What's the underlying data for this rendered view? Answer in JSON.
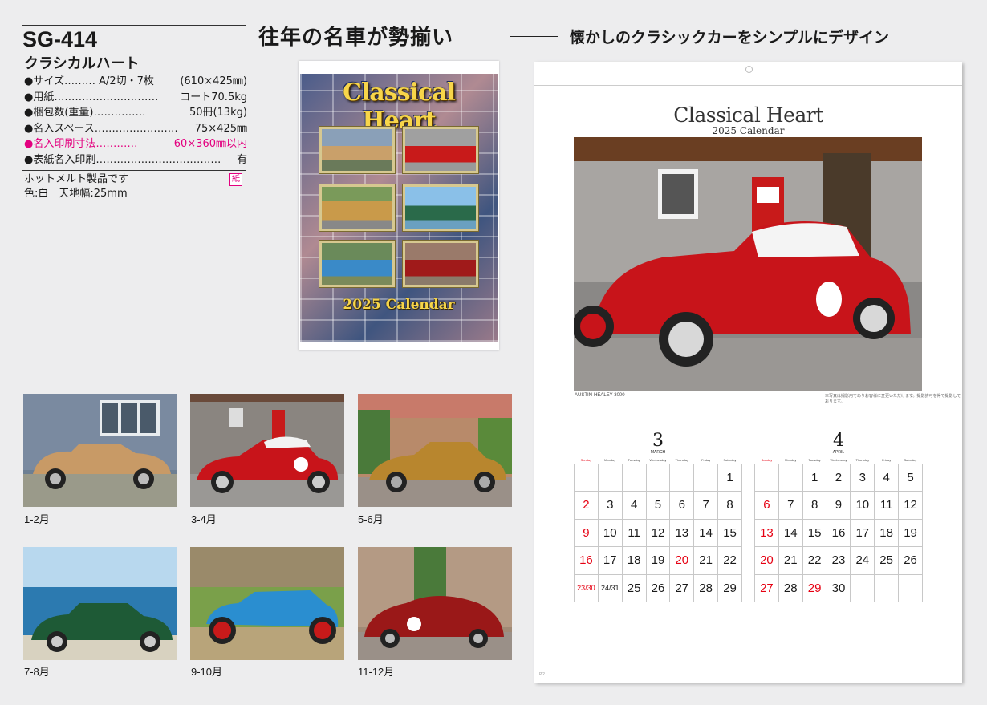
{
  "product": {
    "code": "SG-414",
    "name": "クラシカルハート"
  },
  "specs": [
    {
      "label": "●サイズ……… A/2切・7枚",
      "value": "(610×425㎜)"
    },
    {
      "label": "●用紙…………………………",
      "value": "コート70.5kg"
    },
    {
      "label": "●梱包数(重量)……………",
      "value": "50冊(13kg)"
    },
    {
      "label": "●名入スペース……………………",
      "value": "75×425㎜"
    },
    {
      "label": "●名入印刷寸法…………",
      "value": "60×360㎜以内"
    },
    {
      "label": "●表紙名入印刷………………………………",
      "value": "有"
    }
  ],
  "notes": {
    "line1": "ホットメルト製品です",
    "line2": "色:白　天地幅:25mm",
    "paper_badge": "紙"
  },
  "headline": {
    "main": "往年の名車が勢揃い",
    "sub": "懐かしのクラシックカーをシンプルにデザイン"
  },
  "cover": {
    "title": "Classical Heart",
    "year": "2025 Calendar"
  },
  "thumbnails": [
    {
      "label": "1-2月"
    },
    {
      "label": "3-4月"
    },
    {
      "label": "5-6月"
    },
    {
      "label": "7-8月"
    },
    {
      "label": "9-10月"
    },
    {
      "label": "11-12月"
    }
  ],
  "sheet": {
    "title": "Classical Heart",
    "subtitle": "2025 Calendar",
    "caption": "AUSTIN-HEALEY 3000",
    "caption_right": "本写真は撮影用でありお客様に変更いただけます。撮影許可を得て撮影しております。",
    "footer": "P.2"
  },
  "weekdays": [
    "Sunday",
    "Monday",
    "Tuesday",
    "Wednesday",
    "Thursday",
    "Friday",
    "Saturday"
  ],
  "months": [
    {
      "number": "3",
      "name": "MARCH",
      "weeks": [
        [
          "",
          "",
          "",
          "",
          "",
          "",
          "1"
        ],
        [
          "2",
          "3",
          "4",
          "5",
          "6",
          "7",
          "8"
        ],
        [
          "9",
          "10",
          "11",
          "12",
          "13",
          "14",
          "15"
        ],
        [
          "16",
          "17",
          "18",
          "19",
          "20",
          "21",
          "22"
        ],
        [
          "23/30",
          "24/31",
          "25",
          "26",
          "27",
          "28",
          "29"
        ]
      ],
      "holidays": [
        "20"
      ]
    },
    {
      "number": "4",
      "name": "APRIL",
      "weeks": [
        [
          "",
          "",
          "1",
          "2",
          "3",
          "4",
          "5"
        ],
        [
          "6",
          "7",
          "8",
          "9",
          "10",
          "11",
          "12"
        ],
        [
          "13",
          "14",
          "15",
          "16",
          "17",
          "18",
          "19"
        ],
        [
          "20",
          "21",
          "22",
          "23",
          "24",
          "25",
          "26"
        ],
        [
          "27",
          "28",
          "29",
          "30",
          "",
          "",
          ""
        ]
      ],
      "holidays": [
        "29"
      ]
    }
  ],
  "colors": {
    "accent_pink": "#e3007f",
    "holiday_red": "#e60012"
  }
}
